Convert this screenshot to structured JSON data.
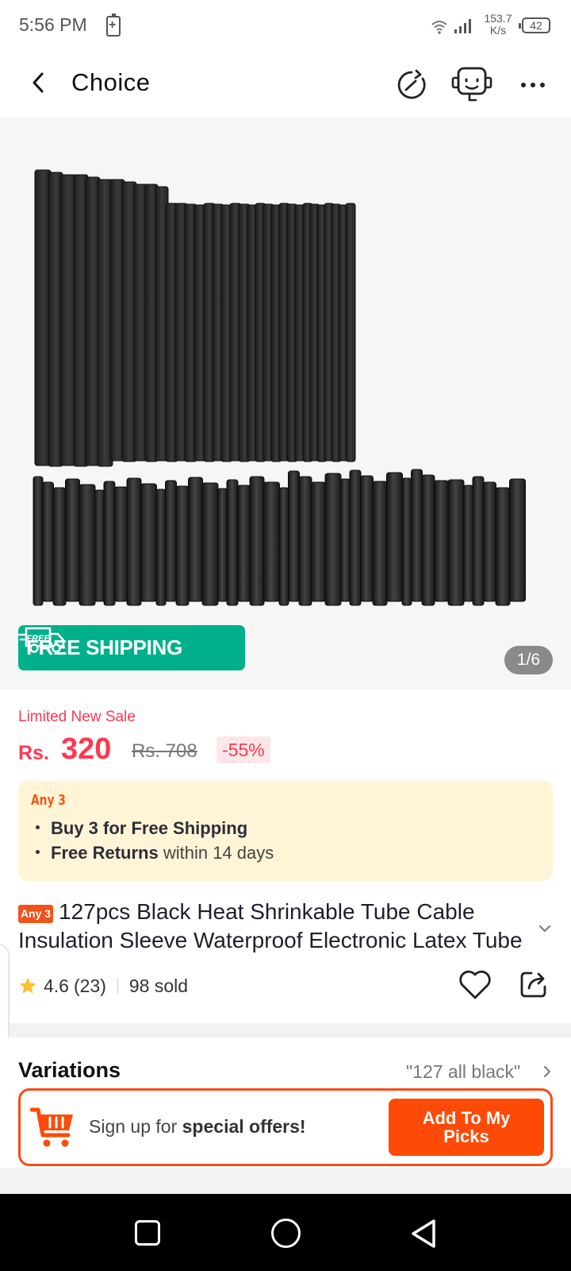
{
  "status_bar": {
    "time": "5:56 PM",
    "network_speed_value": "153.7",
    "network_speed_unit": "K/s",
    "battery_level": "42",
    "icons": [
      "battery-saver-icon",
      "wifi-icon",
      "signal-icon",
      "battery-icon"
    ]
  },
  "header": {
    "title": "Choice",
    "icons": [
      "back-arrow-icon",
      "history-icon",
      "support-bot-icon",
      "more-icon"
    ]
  },
  "gallery": {
    "free_shipping_badge_icon_text": "FREE",
    "free_shipping_label": "FREE SHIPPING",
    "counter": "1/6"
  },
  "pricing": {
    "sale_label": "Limited New Sale",
    "currency": "Rs.",
    "price": "320",
    "original_price": "Rs. 708",
    "discount": "-55%"
  },
  "promo": {
    "badge_label": "Any 3",
    "line1_bold": "Buy 3 for  Free Shipping",
    "line2_bold": "Free Returns",
    "line2_rest": " within 14 days"
  },
  "product": {
    "title_badge": "Any 3",
    "title": "127pcs Black Heat Shrinkable Tube Cable Insulation Sleeve Waterproof Electronic Latex Tube",
    "rating": "4.6",
    "review_count": "(23)",
    "sold": "98 sold"
  },
  "variations": {
    "title": "Variations",
    "selected": "\"127 all black\""
  },
  "signup_banner": {
    "text_prefix": "Sign up for ",
    "text_bold": "special offers!",
    "button_label": "Add To My Picks"
  },
  "colors": {
    "accent_red": "#fd384f",
    "accent_orange": "#fd4a06",
    "free_shipping_green": "#00b08a",
    "promo_background": "#fff4d6"
  }
}
